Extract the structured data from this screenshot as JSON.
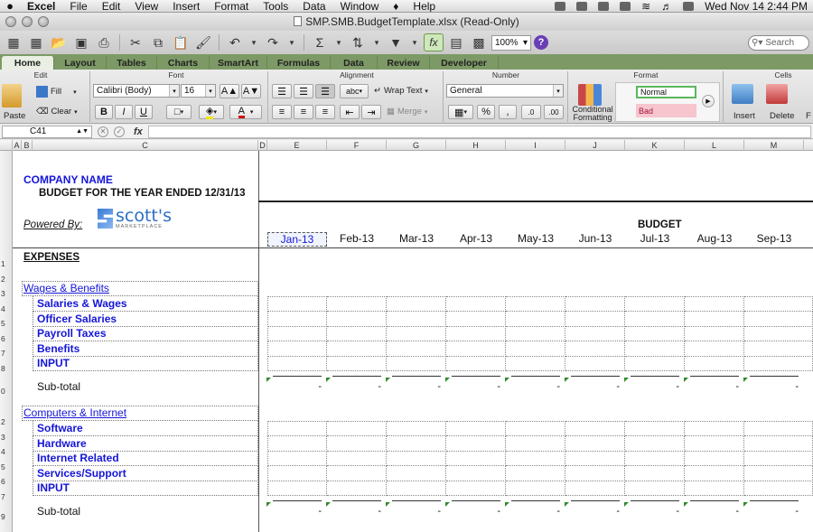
{
  "menubar": {
    "app": "Excel",
    "items": [
      "File",
      "Edit",
      "View",
      "Insert",
      "Format",
      "Tools",
      "Data",
      "Window",
      "Help"
    ],
    "clock": "Wed Nov 14  2:44 PM"
  },
  "window": {
    "title": "SMP.SMB.BudgetTemplate.xlsx  (Read-Only)"
  },
  "toolbar": {
    "zoom": "100%",
    "search_placeholder": "Search"
  },
  "ribbon": {
    "tabs": [
      "Home",
      "Layout",
      "Tables",
      "Charts",
      "SmartArt",
      "Formulas",
      "Data",
      "Review",
      "Developer"
    ],
    "groups": {
      "edit": "Edit",
      "font": "Font",
      "alignment": "Alignment",
      "number": "Number",
      "format": "Format",
      "cells": "Cells"
    },
    "fill_label": "Fill",
    "clear_label": "Clear",
    "paste_label": "Paste",
    "font_name": "Calibri (Body)",
    "font_size": "16",
    "abc_label": "abc",
    "wrap_text_label": "Wrap Text",
    "merge_label": "Merge",
    "number_format": "General",
    "conditional_formatting_label": "Conditional Formatting",
    "style_normal": "Normal",
    "style_bad": "Bad",
    "insert_label": "Insert",
    "delete_label": "Delete",
    "format_label": "F"
  },
  "formula_bar": {
    "cell_ref": "C41",
    "fx": "fx"
  },
  "sheet": {
    "columns": [
      "A",
      "B",
      "C",
      "D",
      "E",
      "F",
      "G",
      "H",
      "I",
      "J",
      "K",
      "L",
      "M"
    ],
    "row_numbers": [
      "",
      "",
      "",
      "",
      "",
      "",
      "1",
      "2",
      "3",
      "4",
      "5",
      "6",
      "7",
      "8",
      "0",
      "",
      "2",
      "3",
      "4",
      "5",
      "6",
      "7",
      "9"
    ],
    "company_name": "COMPANY NAME",
    "budget_line": "BUDGET FOR THE YEAR ENDED 12/31/13",
    "powered_by": "Powered By:",
    "logo_word": "scott's",
    "logo_sub": "MARKETPLACE",
    "budget_header": "BUDGET",
    "months": [
      "Jan-13",
      "Feb-13",
      "Mar-13",
      "Apr-13",
      "May-13",
      "Jun-13",
      "Jul-13",
      "Aug-13",
      "Sep-13"
    ],
    "expenses_label": "EXPENSES",
    "sections": [
      {
        "title": "Wages & Benefits",
        "items": [
          "Salaries & Wages",
          "Officer Salaries",
          "Payroll Taxes",
          "Benefits",
          "INPUT"
        ],
        "subtotal_label": "Sub-total",
        "subtotal_value": "-"
      },
      {
        "title": "Computers & Internet",
        "items": [
          "Software",
          "Hardware",
          "Internet Related",
          "Services/Support",
          "INPUT"
        ],
        "subtotal_label": "Sub-total",
        "subtotal_value": "-"
      }
    ]
  }
}
